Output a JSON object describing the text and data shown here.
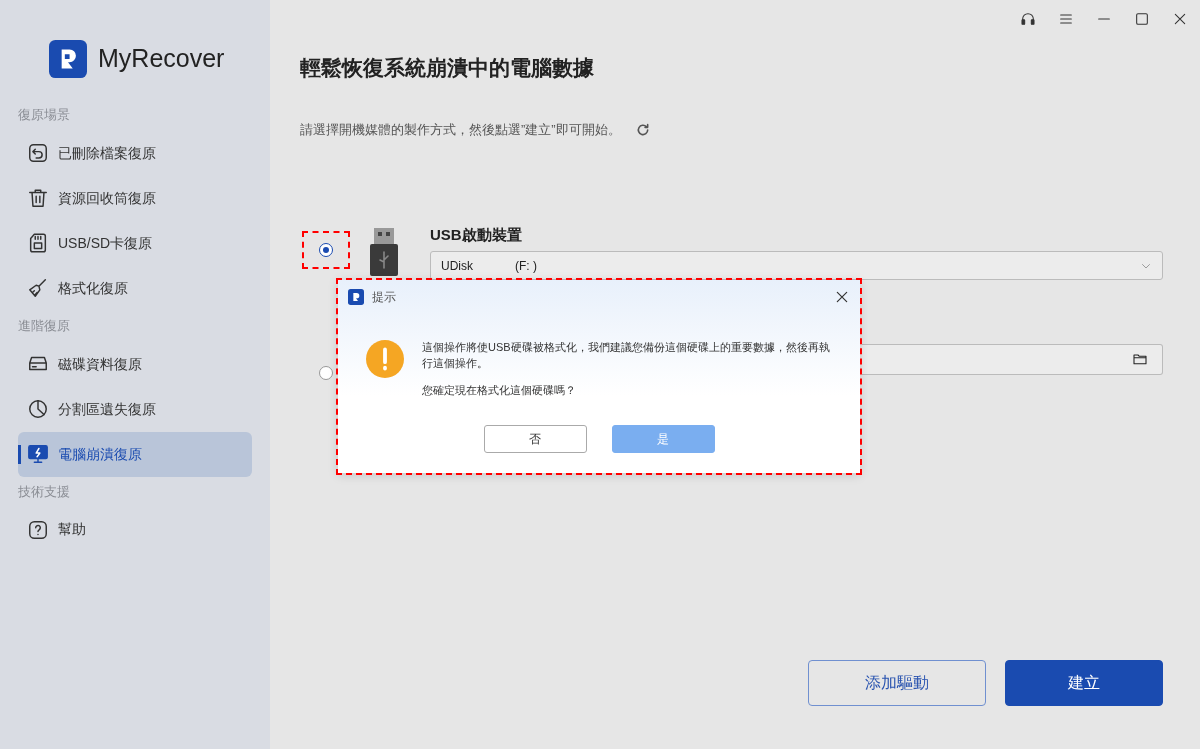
{
  "sidebar": {
    "app_name": "MyRecover",
    "sections": [
      {
        "title": "復原場景",
        "items": [
          {
            "label": "已刪除檔案復原",
            "kind": "undo",
            "selected": false
          },
          {
            "label": "資源回收筒復原",
            "kind": "trash",
            "selected": false
          },
          {
            "label": "USB/SD卡復原",
            "kind": "sdcard",
            "selected": false
          },
          {
            "label": "格式化復原",
            "kind": "broom",
            "selected": false
          }
        ]
      },
      {
        "title": "進階復原",
        "items": [
          {
            "label": "磁碟資料復原",
            "kind": "disk",
            "selected": false
          },
          {
            "label": "分割區遺失復原",
            "kind": "partition",
            "selected": false
          },
          {
            "label": "電腦崩潰復原",
            "kind": "monitor",
            "selected": true
          }
        ]
      },
      {
        "title": "技術支援",
        "items": [
          {
            "label": "幫助",
            "kind": "help",
            "selected": false
          }
        ]
      }
    ]
  },
  "main": {
    "title": "輕鬆恢復系統崩潰中的電腦數據",
    "subtitle": "請選擇開機媒體的製作方式，然後點選”建立”即可開始。",
    "options": [
      {
        "kind": "usb",
        "label": "USB啟動裝置",
        "value": "UDisk",
        "drive": "(F: )",
        "selected": true,
        "highlighted": true
      },
      {
        "kind": "folder",
        "selected": false,
        "highlighted": false
      }
    ],
    "buttons": [
      {
        "label": "添加驅動",
        "kind": "secondary"
      },
      {
        "label": "建立",
        "kind": "primary"
      }
    ]
  },
  "dialog": {
    "title": "提示",
    "message": "這個操作將使USB硬碟被格式化，我們建議您備份這個硬碟上的重要數據，然後再執行這個操作。",
    "question": "您確定現在格式化這個硬碟嗎？",
    "highlighted": true,
    "buttons": [
      {
        "label": "否",
        "kind": "secondary"
      },
      {
        "label": "是",
        "kind": "primary"
      }
    ]
  }
}
